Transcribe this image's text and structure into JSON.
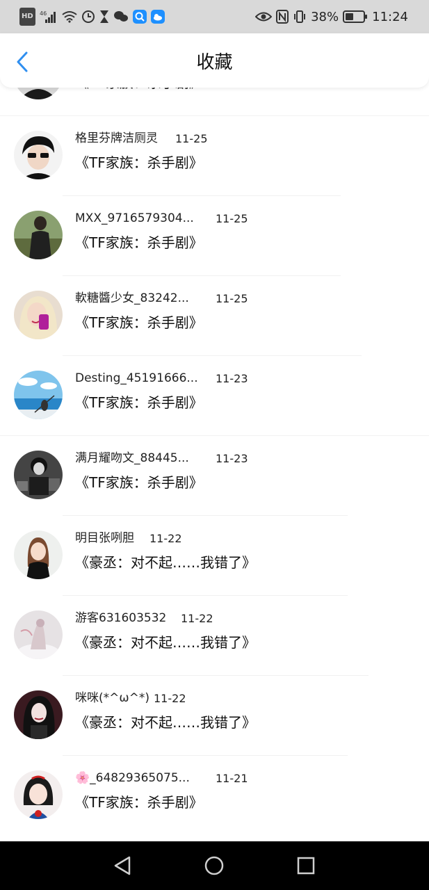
{
  "status_bar": {
    "hd": "HD",
    "signal": "46",
    "battery": "38%",
    "time": "11:24"
  },
  "header": {
    "title": "收藏"
  },
  "items": [
    {
      "user": "",
      "date": "",
      "title": "《TF家族：杀手剧》"
    },
    {
      "user": "格里芬牌洁厕灵",
      "date": "11-25",
      "title": "《TF家族：杀手剧》"
    },
    {
      "user": "MXX_9716579304...",
      "date": "11-25",
      "title": "《TF家族：杀手剧》"
    },
    {
      "user": "軟糖醬少女_83242...",
      "date": "11-25",
      "title": "《TF家族：杀手剧》"
    },
    {
      "user": "Desting_45191666...",
      "date": "11-23",
      "title": "《TF家族：杀手剧》"
    },
    {
      "user": "满月耀吻文_88445...",
      "date": "11-23",
      "title": "《TF家族：杀手剧》"
    },
    {
      "user": "明目张咧胆",
      "date": "11-22",
      "title": "《豪丞：对不起……我错了》"
    },
    {
      "user": "游客631603532",
      "date": "11-22",
      "title": "《豪丞：对不起……我错了》"
    },
    {
      "user": "咪咪(*^ω^*)",
      "date": "11-22",
      "title": "《豪丞：对不起……我错了》"
    },
    {
      "user": "🌸_64829365075...",
      "date": "11-21",
      "title": "《TF家族：杀手剧》"
    }
  ],
  "colors": {
    "accent": "#2f8ff0",
    "status_bar_bg": "#d9d9d9",
    "nav_bar_bg": "#000000"
  }
}
